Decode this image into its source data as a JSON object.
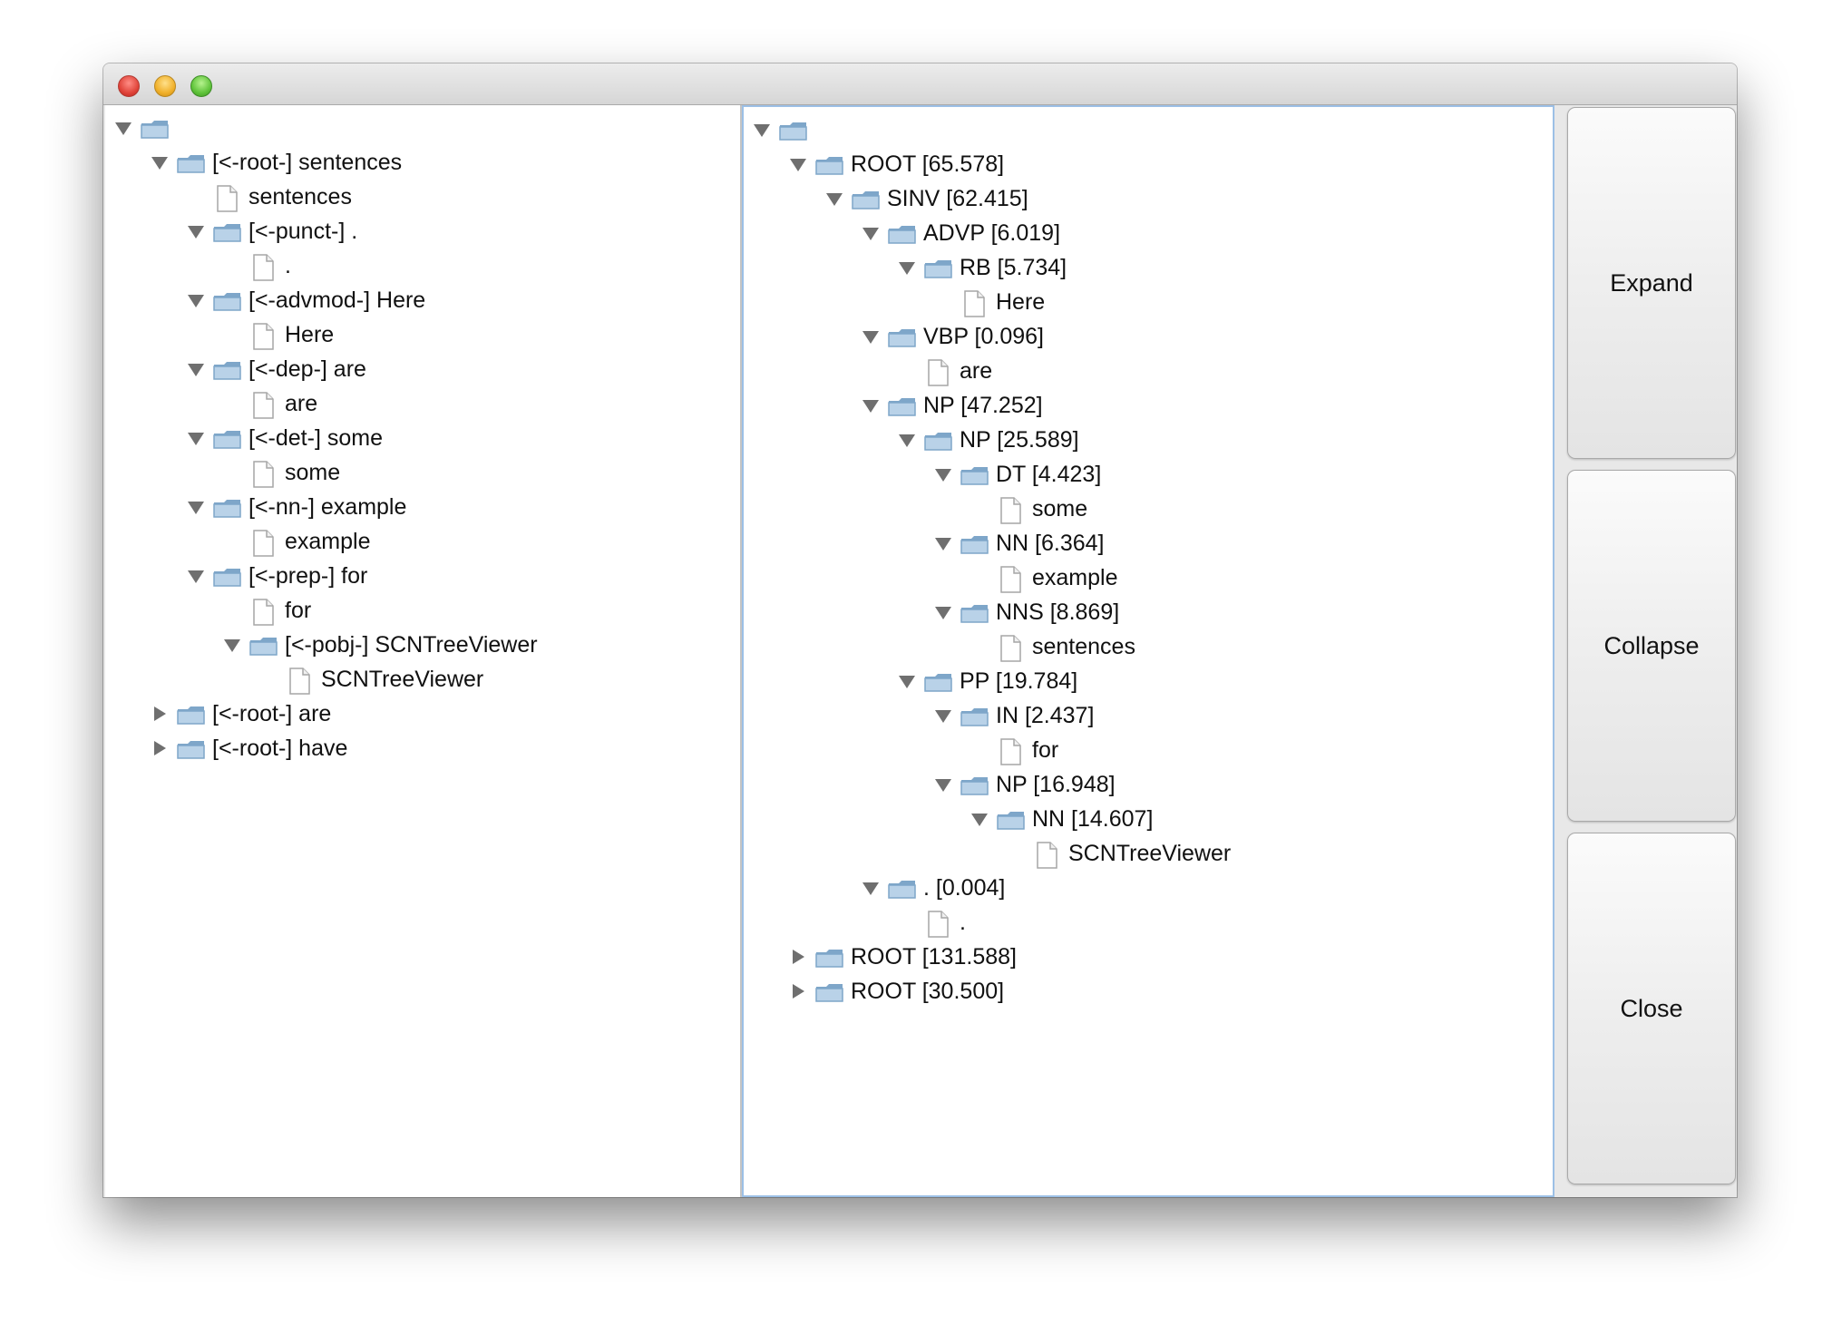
{
  "window": {
    "controls": [
      "close",
      "minimize",
      "zoom"
    ]
  },
  "dependency_tree": [
    {
      "depth": 0,
      "toggle": "expanded",
      "icon": "folder",
      "label": ""
    },
    {
      "depth": 1,
      "toggle": "expanded",
      "icon": "folder",
      "label": "[<-root-] sentences"
    },
    {
      "depth": 2,
      "toggle": "none",
      "icon": "file",
      "label": "sentences"
    },
    {
      "depth": 2,
      "toggle": "expanded",
      "icon": "folder",
      "label": "[<-punct-] ."
    },
    {
      "depth": 3,
      "toggle": "none",
      "icon": "file",
      "label": "."
    },
    {
      "depth": 2,
      "toggle": "expanded",
      "icon": "folder",
      "label": "[<-advmod-] Here"
    },
    {
      "depth": 3,
      "toggle": "none",
      "icon": "file",
      "label": "Here"
    },
    {
      "depth": 2,
      "toggle": "expanded",
      "icon": "folder",
      "label": "[<-dep-] are"
    },
    {
      "depth": 3,
      "toggle": "none",
      "icon": "file",
      "label": "are"
    },
    {
      "depth": 2,
      "toggle": "expanded",
      "icon": "folder",
      "label": "[<-det-] some"
    },
    {
      "depth": 3,
      "toggle": "none",
      "icon": "file",
      "label": "some"
    },
    {
      "depth": 2,
      "toggle": "expanded",
      "icon": "folder",
      "label": "[<-nn-] example"
    },
    {
      "depth": 3,
      "toggle": "none",
      "icon": "file",
      "label": "example"
    },
    {
      "depth": 2,
      "toggle": "expanded",
      "icon": "folder",
      "label": "[<-prep-] for"
    },
    {
      "depth": 3,
      "toggle": "none",
      "icon": "file",
      "label": "for"
    },
    {
      "depth": 3,
      "toggle": "expanded",
      "icon": "folder",
      "label": "[<-pobj-] SCNTreeViewer"
    },
    {
      "depth": 4,
      "toggle": "none",
      "icon": "file",
      "label": "SCNTreeViewer"
    },
    {
      "depth": 1,
      "toggle": "collapsed",
      "icon": "folder",
      "label": "[<-root-] are"
    },
    {
      "depth": 1,
      "toggle": "collapsed",
      "icon": "folder",
      "label": "[<-root-] have"
    }
  ],
  "parse_tree": [
    {
      "depth": 0,
      "toggle": "expanded",
      "icon": "folder",
      "label": ""
    },
    {
      "depth": 1,
      "toggle": "expanded",
      "icon": "folder",
      "label": "ROOT [65.578]"
    },
    {
      "depth": 2,
      "toggle": "expanded",
      "icon": "folder",
      "label": "SINV [62.415]"
    },
    {
      "depth": 3,
      "toggle": "expanded",
      "icon": "folder",
      "label": "ADVP [6.019]"
    },
    {
      "depth": 4,
      "toggle": "expanded",
      "icon": "folder",
      "label": "RB [5.734]"
    },
    {
      "depth": 5,
      "toggle": "none",
      "icon": "file",
      "label": "Here"
    },
    {
      "depth": 3,
      "toggle": "expanded",
      "icon": "folder",
      "label": "VBP [0.096]"
    },
    {
      "depth": 4,
      "toggle": "none",
      "icon": "file",
      "label": "are"
    },
    {
      "depth": 3,
      "toggle": "expanded",
      "icon": "folder",
      "label": "NP [47.252]"
    },
    {
      "depth": 4,
      "toggle": "expanded",
      "icon": "folder",
      "label": "NP [25.589]"
    },
    {
      "depth": 5,
      "toggle": "expanded",
      "icon": "folder",
      "label": "DT [4.423]"
    },
    {
      "depth": 6,
      "toggle": "none",
      "icon": "file",
      "label": "some"
    },
    {
      "depth": 5,
      "toggle": "expanded",
      "icon": "folder",
      "label": "NN [6.364]"
    },
    {
      "depth": 6,
      "toggle": "none",
      "icon": "file",
      "label": "example"
    },
    {
      "depth": 5,
      "toggle": "expanded",
      "icon": "folder",
      "label": "NNS [8.869]"
    },
    {
      "depth": 6,
      "toggle": "none",
      "icon": "file",
      "label": "sentences"
    },
    {
      "depth": 4,
      "toggle": "expanded",
      "icon": "folder",
      "label": "PP [19.784]"
    },
    {
      "depth": 5,
      "toggle": "expanded",
      "icon": "folder",
      "label": "IN [2.437]"
    },
    {
      "depth": 6,
      "toggle": "none",
      "icon": "file",
      "label": "for"
    },
    {
      "depth": 5,
      "toggle": "expanded",
      "icon": "folder",
      "label": "NP [16.948]"
    },
    {
      "depth": 6,
      "toggle": "expanded",
      "icon": "folder",
      "label": "NN [14.607]"
    },
    {
      "depth": 7,
      "toggle": "none",
      "icon": "file",
      "label": "SCNTreeViewer"
    },
    {
      "depth": 3,
      "toggle": "expanded",
      "icon": "folder",
      "label": ". [0.004]"
    },
    {
      "depth": 4,
      "toggle": "none",
      "icon": "file",
      "label": "."
    },
    {
      "depth": 1,
      "toggle": "collapsed",
      "icon": "folder",
      "label": "ROOT [131.588]"
    },
    {
      "depth": 1,
      "toggle": "collapsed",
      "icon": "folder",
      "label": "ROOT [30.500]"
    }
  ],
  "buttons": {
    "expand_label": "Expand",
    "collapse_label": "Collapse",
    "close_label": "Close"
  },
  "colors": {
    "folder": "#7ea6c9",
    "folder_light": "#b9d2e8",
    "selection_border": "#9cc0e6"
  }
}
